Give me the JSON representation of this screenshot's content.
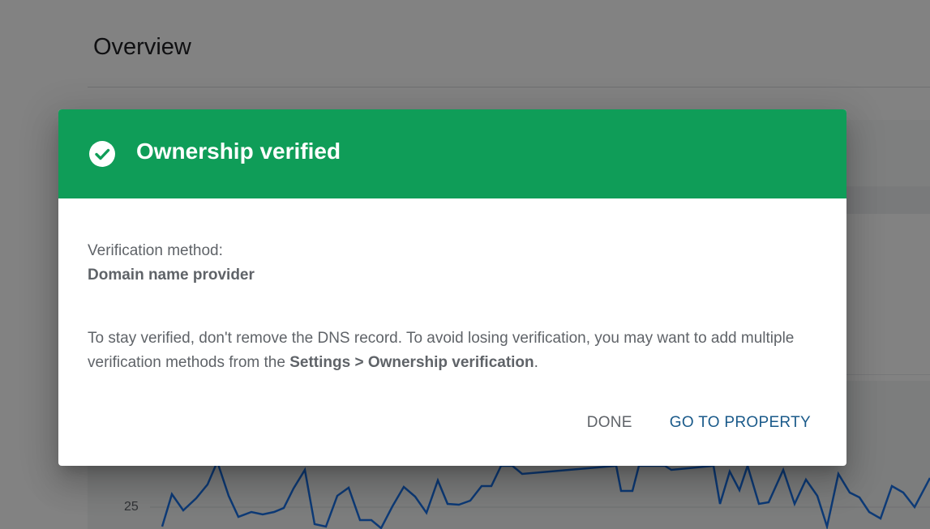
{
  "page": {
    "title": "Overview",
    "chart_tick_label": "25",
    "chart_line_color": "#1a73e8"
  },
  "dialog": {
    "title": "Ownership verified",
    "header_color": "#0f9d58",
    "icon": "check-circle-icon",
    "method_label": "Verification method:",
    "method_value": "Domain name provider",
    "message_before": "To stay verified, don't remove the DNS record. To avoid losing verification, you may want to add multiple verification methods from the ",
    "message_bold": "Settings > Ownership verification",
    "message_after": ".",
    "buttons": {
      "done": "DONE",
      "go_to_property": "GO TO PROPERTY"
    }
  }
}
